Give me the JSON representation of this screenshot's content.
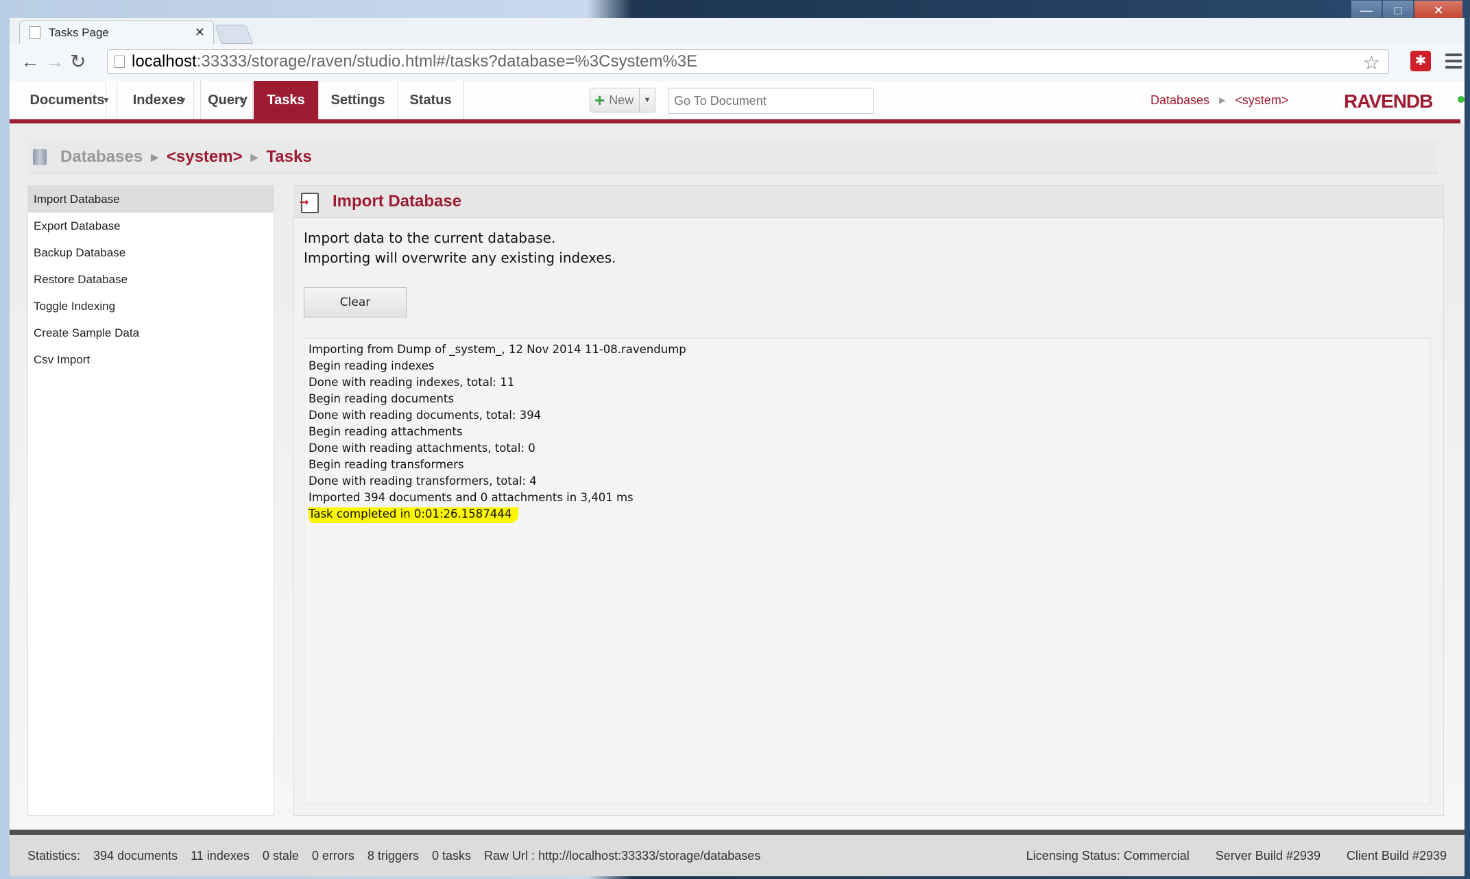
{
  "browser": {
    "tab_title": "Tasks Page",
    "url_host": "localhost",
    "url_rest": ":33333/storage/raven/studio.html#/tasks?database=%3Csystem%3E"
  },
  "nav": {
    "items": [
      "Documents",
      "Indexes",
      "Query",
      "Tasks",
      "Settings",
      "Status"
    ],
    "active": "Tasks",
    "new_label": "New",
    "goto_placeholder": "Go To Document",
    "crumb_databases": "Databases",
    "crumb_system": "<system>",
    "logo": "RAVENDB"
  },
  "breadcrumb": {
    "databases": "Databases",
    "system": "<system>",
    "tasks": "Tasks"
  },
  "sidebar": {
    "items": [
      {
        "label": "Import Database"
      },
      {
        "label": "Export Database"
      },
      {
        "label": "Backup Database"
      },
      {
        "label": "Restore Database"
      },
      {
        "label": "Toggle Indexing"
      },
      {
        "label": "Create Sample Data"
      },
      {
        "label": "Csv Import"
      }
    ]
  },
  "content": {
    "title": "Import Database",
    "desc_line1": "Import data to the current database.",
    "desc_line2": "Importing will overwrite any existing indexes.",
    "clear_label": "Clear",
    "log": [
      "Importing from Dump of _system_, 12 Nov 2014 11-08.ravendump",
      "Begin reading indexes",
      "Done with reading indexes, total: 11",
      "Begin reading documents",
      "Done with reading documents, total: 394",
      "Begin reading attachments",
      "Done with reading attachments, total: 0",
      "Begin reading transformers",
      "Done with reading transformers, total: 4",
      "Imported 394 documents and 0 attachments in 3,401 ms",
      "Task completed in 0:01:26.1587444"
    ]
  },
  "statusbar": {
    "statistics_label": "Statistics:",
    "documents": "394 documents",
    "indexes": "11 indexes",
    "stale": "0 stale",
    "errors": "0 errors",
    "triggers": "8 triggers",
    "tasks": "0 tasks",
    "raw_url": "Raw Url : http://localhost:33333/storage/databases",
    "licensing": "Licensing Status:  Commercial",
    "server_build": "Server Build #2939",
    "client_build": "Client Build #2939"
  },
  "colors": {
    "brand": "#9e1c32",
    "highlight": "#fbf700"
  }
}
